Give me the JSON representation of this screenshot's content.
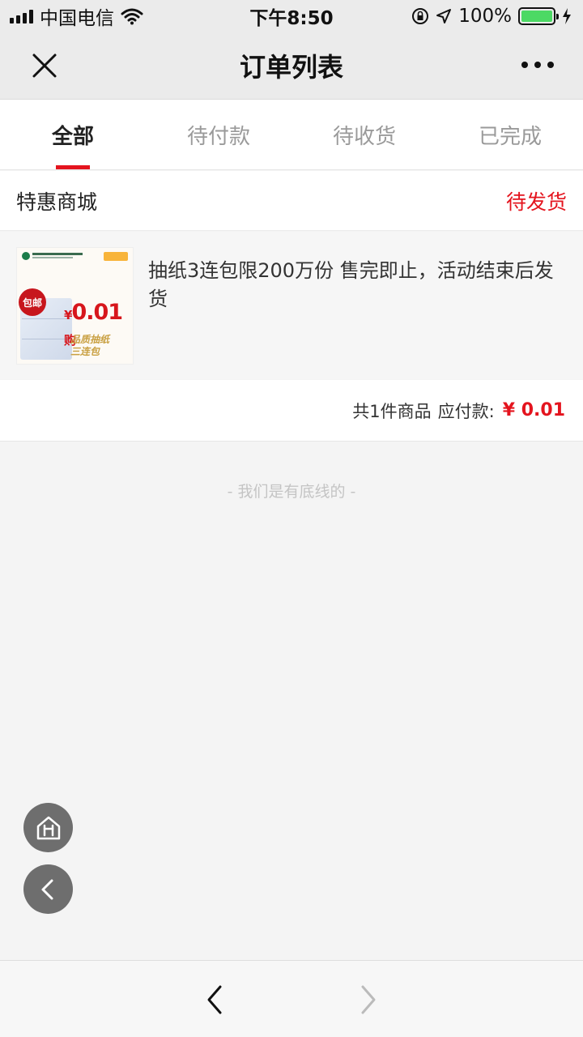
{
  "status_bar": {
    "carrier": "中国电信",
    "time": "下午8:50",
    "battery": "100%",
    "battery_level": 1.0
  },
  "nav": {
    "title": "订单列表"
  },
  "tabs": [
    {
      "label": "全部",
      "active": true
    },
    {
      "label": "待付款",
      "active": false
    },
    {
      "label": "待收货",
      "active": false
    },
    {
      "label": "已完成",
      "active": false
    }
  ],
  "order": {
    "shop_name": "特惠商城",
    "status": "待发货",
    "product": {
      "title": "抽纸3连包限200万份 售完即止，活动结束后发货",
      "thumb": {
        "badge": "包邮",
        "price_yen": "¥",
        "price": "0.01",
        "price_suffix": "购",
        "tag_line1": "品质抽纸",
        "tag_line2": "三连包"
      }
    },
    "summary": {
      "count_text": "共1件商品",
      "payable_label": "应付款:",
      "payable_amount": "¥ 0.01"
    }
  },
  "footer_note": "- 我们是有底线的 -",
  "colors": {
    "accent": "#e4141e",
    "nav_bg": "#ebebeb",
    "page_bg": "#f4f4f4"
  }
}
